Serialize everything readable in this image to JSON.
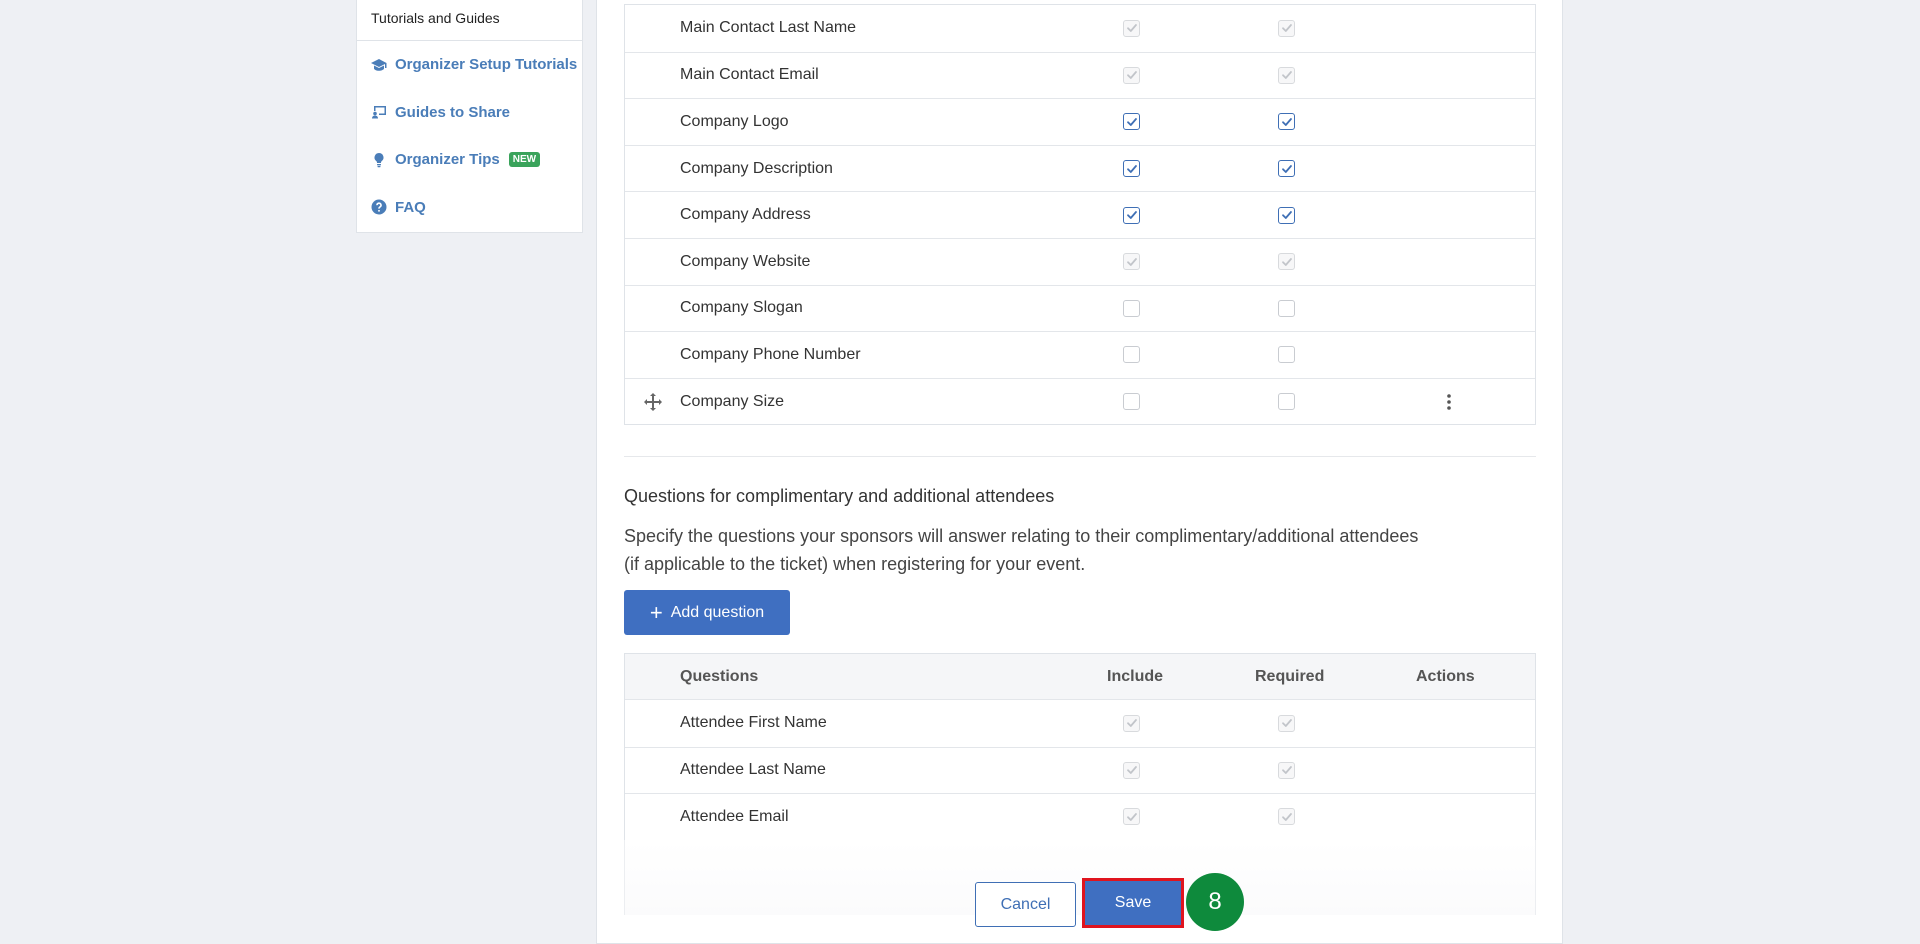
{
  "sidebar": {
    "title": "Tutorials and Guides",
    "items": [
      {
        "label": "Organizer Setup Tutorials",
        "icon": "graduation-cap-icon"
      },
      {
        "label": "Guides to Share",
        "icon": "share-screen-icon"
      },
      {
        "label": "Organizer Tips",
        "icon": "lightbulb-icon",
        "badge": "NEW"
      },
      {
        "label": "FAQ",
        "icon": "question-circle-icon"
      }
    ]
  },
  "sponsor_questions": {
    "rows": [
      {
        "label": "Main Contact Last Name",
        "include": "checked-disabled",
        "required": "checked-disabled"
      },
      {
        "label": "Main Contact Email",
        "include": "checked-disabled",
        "required": "checked-disabled"
      },
      {
        "label": "Company Logo",
        "include": "checked",
        "required": "checked"
      },
      {
        "label": "Company Description",
        "include": "checked",
        "required": "checked"
      },
      {
        "label": "Company Address",
        "include": "checked",
        "required": "checked"
      },
      {
        "label": "Company Website",
        "include": "checked-disabled",
        "required": "checked-disabled"
      },
      {
        "label": "Company Slogan",
        "include": "unchecked",
        "required": "unchecked"
      },
      {
        "label": "Company Phone Number",
        "include": "unchecked",
        "required": "unchecked"
      },
      {
        "label": "Company Size",
        "include": "unchecked",
        "required": "unchecked",
        "draggable": true,
        "has_actions": true
      }
    ]
  },
  "attendee_section": {
    "title": "Questions for complimentary and additional attendees",
    "description": "Specify the questions your sponsors will answer relating to their complimentary/additional attendees (if applicable to the ticket) when registering for your event.",
    "add_button": "Add question",
    "columns": {
      "questions": "Questions",
      "include": "Include",
      "required": "Required",
      "actions": "Actions"
    },
    "rows": [
      {
        "label": "Attendee First Name",
        "include": "checked-disabled",
        "required": "checked-disabled"
      },
      {
        "label": "Attendee Last Name",
        "include": "checked-disabled",
        "required": "checked-disabled"
      },
      {
        "label": "Attendee Email",
        "include": "checked-disabled",
        "required": "checked-disabled"
      }
    ]
  },
  "footer": {
    "cancel_label": "Cancel",
    "save_label": "Save",
    "step_number": "8"
  },
  "colors": {
    "accent": "#3f6fc1",
    "link": "#4a7db8",
    "new_badge": "#3aa35b",
    "highlight": "#e0141e",
    "step_badge": "#0e8a3c"
  }
}
